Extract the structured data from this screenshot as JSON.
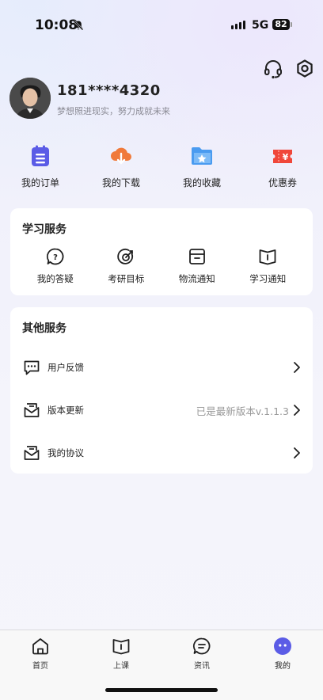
{
  "status_bar": {
    "time": "10:08",
    "network": "5G",
    "battery": "82"
  },
  "header": {
    "support_icon": "headset-icon",
    "settings_icon": "gear-icon",
    "phone": "181****4320",
    "motto": "梦想照进现实，努力成就未来"
  },
  "quick_actions": [
    {
      "label": "我的订单",
      "icon": "order-list-icon",
      "color": "#5b5ce6"
    },
    {
      "label": "我的下载",
      "icon": "cloud-download-icon",
      "color": "#f07a3a"
    },
    {
      "label": "我的收藏",
      "icon": "star-folder-icon",
      "color": "#4a9bf0"
    },
    {
      "label": "优惠券",
      "icon": "coupon-icon",
      "color": "#f0473a"
    }
  ],
  "study_services": {
    "title": "学习服务",
    "items": [
      {
        "label": "我的答疑",
        "icon": "question-icon"
      },
      {
        "label": "考研目标",
        "icon": "target-icon"
      },
      {
        "label": "物流通知",
        "icon": "package-icon"
      },
      {
        "label": "学习通知",
        "icon": "book-icon"
      }
    ]
  },
  "other_services": {
    "title": "其他服务",
    "items": [
      {
        "label": "用户反馈",
        "icon": "feedback-icon",
        "value": ""
      },
      {
        "label": "版本更新",
        "icon": "mail-icon",
        "value": "已是最新版本v.1.1.3"
      },
      {
        "label": "我的协议",
        "icon": "agreement-icon",
        "value": ""
      }
    ]
  },
  "tabbar": [
    {
      "label": "首页",
      "icon": "home-icon"
    },
    {
      "label": "上课",
      "icon": "class-book-icon"
    },
    {
      "label": "资讯",
      "icon": "chat-icon"
    },
    {
      "label": "我的",
      "icon": "profile-icon",
      "active": true
    }
  ],
  "colors": {
    "accent": "#5b5ce6",
    "background": "#f3f3fb"
  }
}
